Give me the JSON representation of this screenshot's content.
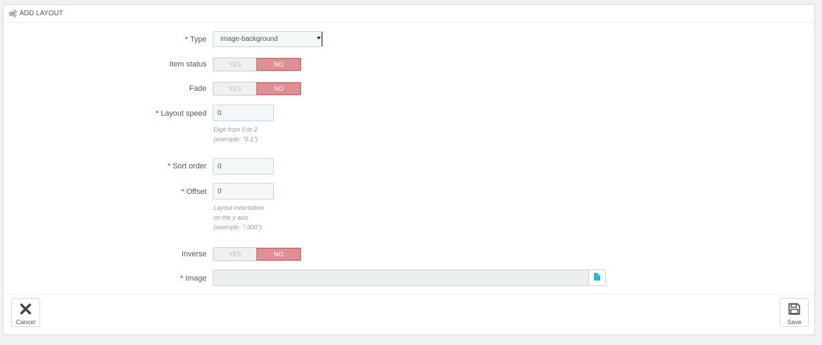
{
  "panel": {
    "title": "ADD LAYOUT",
    "title_icon": "cogs-icon"
  },
  "form": {
    "type": {
      "label": "Type",
      "required": "*",
      "value": "image-background"
    },
    "item_status": {
      "label": "Item status",
      "yes": "YES",
      "no": "NO",
      "selected": "NO"
    },
    "fade": {
      "label": "Fade",
      "yes": "YES",
      "no": "NO",
      "selected": "NO"
    },
    "layout_speed": {
      "label": "Layout speed",
      "required": "*",
      "value": "0",
      "help_line1": "Digit from 0 to 2",
      "help_line2": "(exemple: \"0.1\")"
    },
    "sort_order": {
      "label": "Sort order",
      "required": "*",
      "value": "0"
    },
    "offset": {
      "label": "Offset",
      "required": "*",
      "value": "0",
      "help_line1": "Layout indentation",
      "help_line2": "on the y axis",
      "help_line3": "(exemple: \"-300\")"
    },
    "inverse": {
      "label": "Inverse",
      "yes": "YES",
      "no": "NO",
      "selected": "NO"
    },
    "image": {
      "label": "Image",
      "required": "*",
      "value": "",
      "button_icon": "file-icon"
    }
  },
  "footer": {
    "cancel_label": "Cancel",
    "save_label": "Save"
  },
  "colors": {
    "required": "#e3151a",
    "switch_active": "#e08f95",
    "file_icon": "#25b9d7"
  }
}
